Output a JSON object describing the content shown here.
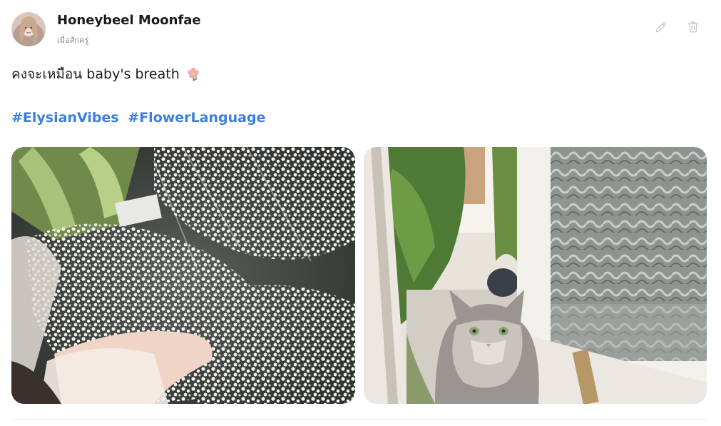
{
  "post": {
    "author": {
      "name": "Honeybeel Moonfae",
      "avatar_icon": "avatar-photo"
    },
    "time_label": "เมื่อสักครู่",
    "text": "คงจะเหมือน baby's breath",
    "text_emoji_icon": "flower-emoji-icon",
    "hashtags": [
      "#ElysianVibes",
      "#FlowerLanguage"
    ],
    "actions": {
      "edit_icon": "pencil-icon",
      "delete_icon": "trash-icon"
    },
    "images": [
      {
        "description_icon": "babys-breath-bouquet-photo"
      },
      {
        "description_icon": "cat-at-doorway-photo"
      }
    ],
    "colors": {
      "hashtag": "#3b7ee0",
      "action_icon": "#c8c8c8",
      "time_text": "#8e8e8e"
    }
  }
}
